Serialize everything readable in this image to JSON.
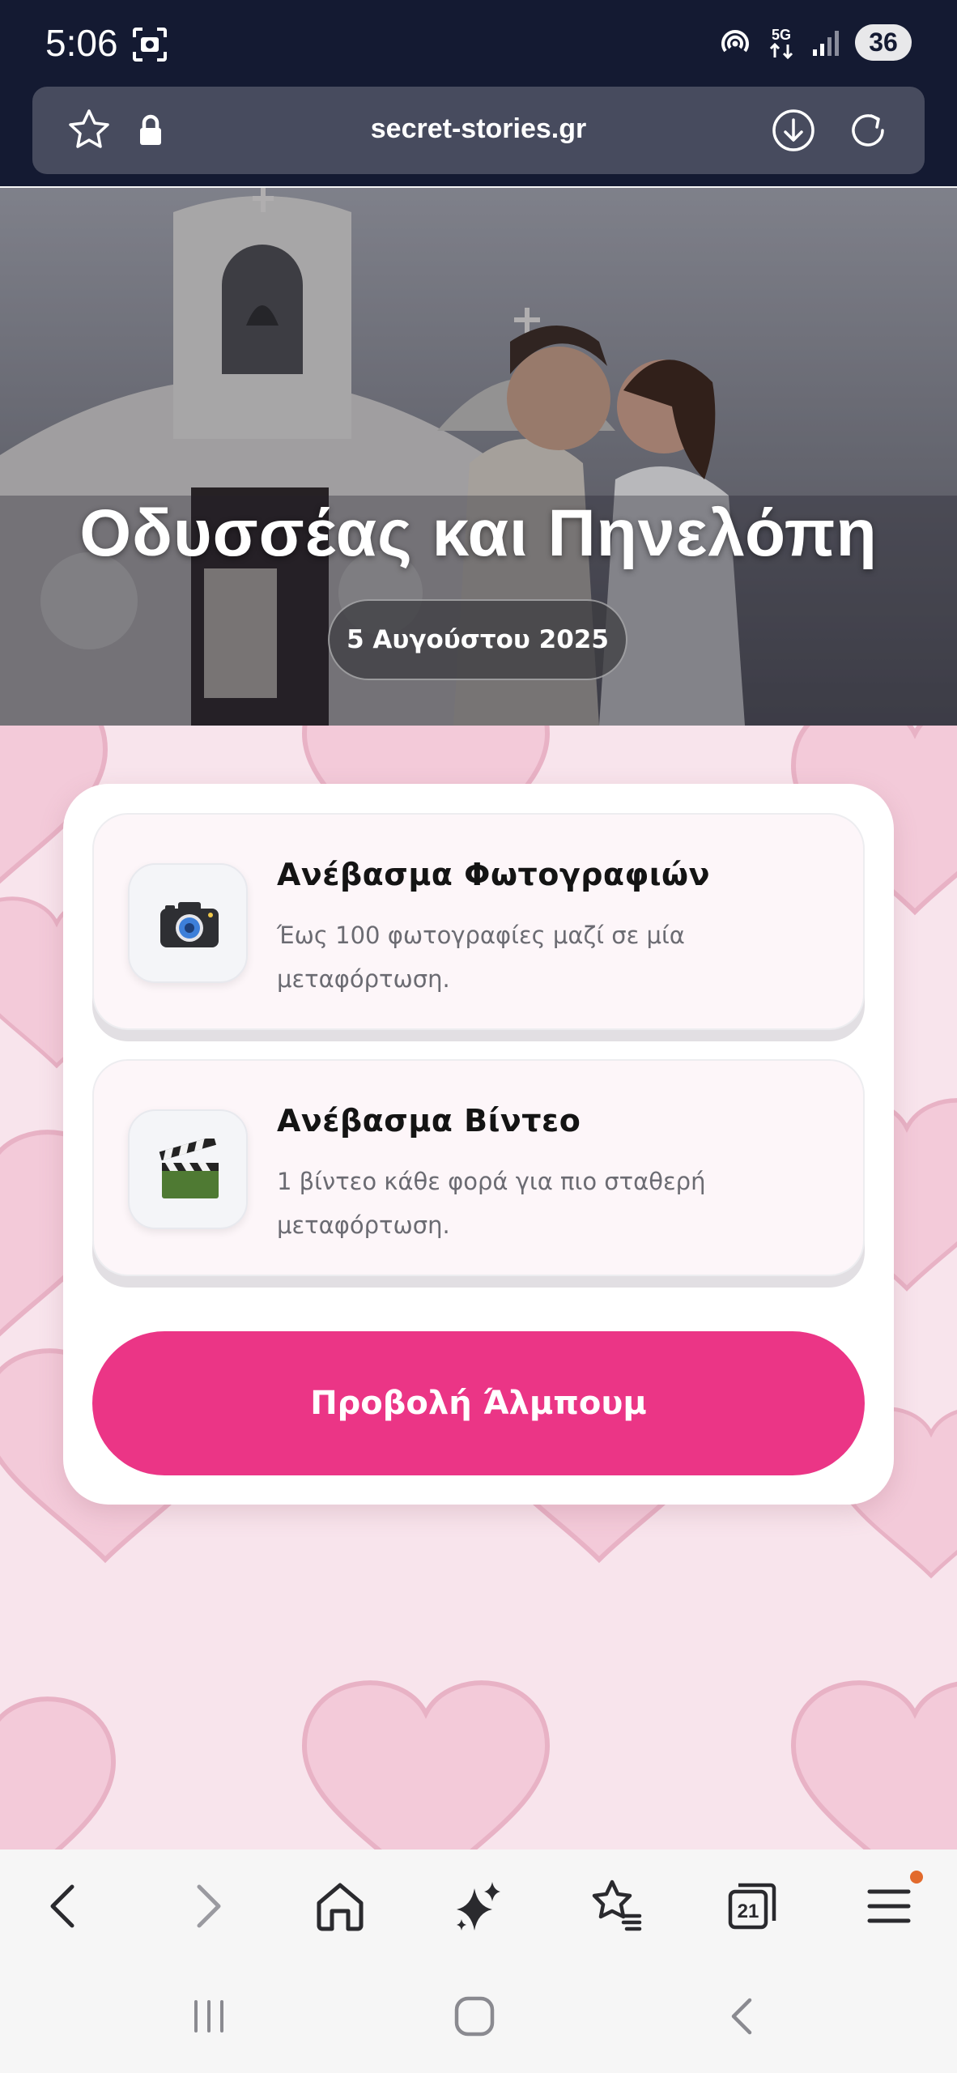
{
  "status_bar": {
    "time": "5:06",
    "network": "5G",
    "battery": "36",
    "icons": [
      "screenshot-icon",
      "hotspot-icon",
      "5g-icon",
      "signal-icon",
      "battery-icon"
    ]
  },
  "browser": {
    "url": "secret-stories.gr",
    "icons": [
      "bookmark-star-icon",
      "lock-icon",
      "download-icon",
      "reload-icon"
    ]
  },
  "hero": {
    "title": "Οδυσσέας και Πηνελόπη",
    "date": "5 Αυγούστου 2025"
  },
  "upload_options": [
    {
      "title": "Ανέβασμα Φωτογραφιών",
      "description": "Έως 100 φωτογραφίες μαζί σε μία μεταφόρτωση.",
      "icon": "camera-icon"
    },
    {
      "title": "Ανέβασμα Βίντεο",
      "description": "1 βίντεο κάθε φορά για πιο σταθερή μεταφόρτωση.",
      "icon": "clapperboard-icon"
    }
  ],
  "album_button": "Προβολή Άλμπουμ",
  "toolbar": {
    "tabs_count": "21",
    "items": [
      "back-icon",
      "forward-icon",
      "home-icon",
      "ai-sparkle-icon",
      "bookmarks-icon",
      "tabs-icon",
      "menu-icon"
    ]
  },
  "colors": {
    "status_bg": "#141a32",
    "accent_pink": "#eb3586",
    "hearts_bg": "#f8e4ec",
    "heart_fill": "#f3c6d6",
    "heart_stroke": "#e6a9bf",
    "notification_dot": "#e26a2c"
  }
}
